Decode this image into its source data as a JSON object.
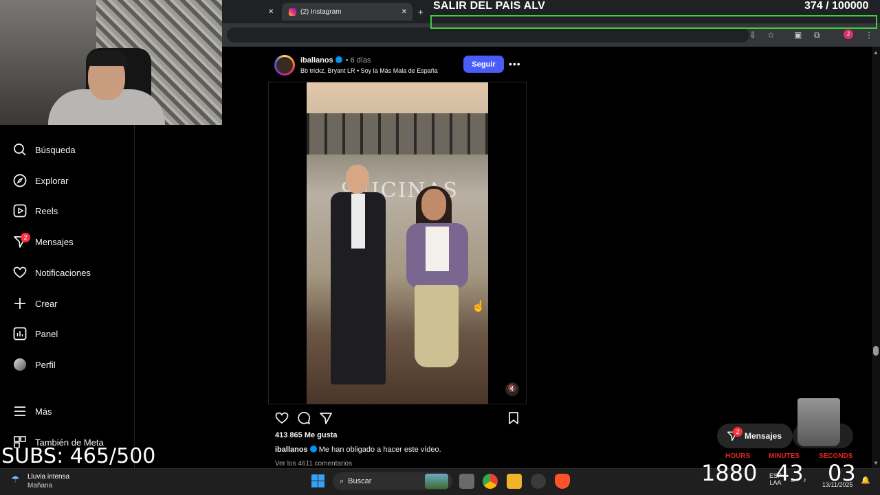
{
  "browser": {
    "tabs": [
      {
        "label": ""
      },
      {
        "label": "(2) Instagram"
      }
    ],
    "new_tab": "+"
  },
  "overlay": {
    "title": "SALIR DEL PAIS ALV",
    "count": "374  / 100000"
  },
  "sidebar": {
    "items": [
      {
        "label": "Búsqueda",
        "icon": "search-icon"
      },
      {
        "label": "Explorar",
        "icon": "compass-icon"
      },
      {
        "label": "Reels",
        "icon": "reels-icon"
      },
      {
        "label": "Mensajes",
        "icon": "messenger-icon",
        "badge": "2"
      },
      {
        "label": "Notificaciones",
        "icon": "heart-icon"
      },
      {
        "label": "Crear",
        "icon": "plus-icon"
      },
      {
        "label": "Panel",
        "icon": "dashboard-icon"
      },
      {
        "label": "Perfil",
        "icon": "avatar"
      },
      {
        "label": "Más",
        "icon": "menu-icon"
      },
      {
        "label": "También de Meta",
        "icon": "meta-icon"
      }
    ]
  },
  "stream": {
    "subs": "SUBS: 465/500"
  },
  "post": {
    "username": "iballanos",
    "time": "• 6 días",
    "subtitle": "Bb trickz, Bryant LR • Soy la Más Mala de España",
    "follow": "Seguir",
    "more": "•••",
    "video_sign": "9FICINAS",
    "likes": "413 865 Me gusta",
    "caption_user": "iballanos",
    "caption_text": "Me han obligado a hacer este vídeo.",
    "comments": "Ver los 4611 comentarios"
  },
  "messages": {
    "label": "Mensajes",
    "badge": "2"
  },
  "timer": {
    "hours_label": "HOURS",
    "minutes_label": "MINUTES",
    "seconds_label": "SECONDS",
    "hours": "1880",
    "minutes": "43",
    "seconds": "03"
  },
  "taskbar": {
    "weather_title": "Lluvia intensa",
    "weather_sub": "Mañana",
    "search": "Buscar",
    "lang1": "ESP",
    "lang2": "LAA",
    "date": "13/11/2025"
  },
  "colors": {
    "accent": "#4a5df9",
    "badge": "#ff3040",
    "overlay_bar": "#3ecf3e",
    "timer_label": "#e0261d"
  }
}
